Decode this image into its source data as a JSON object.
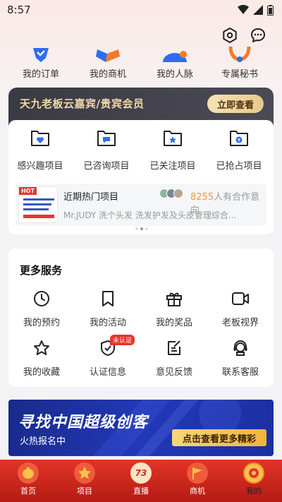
{
  "status_bar": {
    "time": "8:57"
  },
  "top_actions": {
    "settings_icon": "gear-icon",
    "message_icon": "chat-bubble-icon"
  },
  "quick_links": [
    {
      "label": "我的订单",
      "icon": "order-icon"
    },
    {
      "label": "我的商机",
      "icon": "opportunity-icon"
    },
    {
      "label": "我的人脉",
      "icon": "contacts-icon"
    },
    {
      "label": "专属秘书",
      "icon": "secretary-icon"
    }
  ],
  "vip": {
    "title": "天九老板云嘉宾/贵宾会员",
    "button": "立即查看"
  },
  "projects": {
    "items": [
      {
        "label": "感兴趣项目",
        "icon": "folder-heart-icon"
      },
      {
        "label": "已咨询项目",
        "icon": "folder-chat-icon"
      },
      {
        "label": "已关注项目",
        "icon": "folder-star-icon"
      },
      {
        "label": "已抢占项目",
        "icon": "folder-money-icon"
      }
    ],
    "hot": {
      "tag": "HOT",
      "title": "近期热门项目",
      "count": "8255",
      "count_suffix": "人有合作意向",
      "desc": "Mr.JUDY 洗个头发 洗发护发及头皮管理综合..."
    }
  },
  "services": {
    "title": "更多服务",
    "items": [
      {
        "label": "我的预约",
        "icon": "clock-icon"
      },
      {
        "label": "我的活动",
        "icon": "bookmark-icon"
      },
      {
        "label": "我的奖品",
        "icon": "gift-icon"
      },
      {
        "label": "老板视界",
        "icon": "video-camera-icon"
      },
      {
        "label": "我的收藏",
        "icon": "star-icon"
      },
      {
        "label": "认证信息",
        "icon": "shield-check-icon",
        "badge": "未认证"
      },
      {
        "label": "意见反馈",
        "icon": "feedback-icon"
      },
      {
        "label": "联系客服",
        "icon": "headset-icon"
      }
    ]
  },
  "promo": {
    "title": "寻找中国超级创客",
    "subtitle": "火热报名中",
    "button": "点击查看更多精彩"
  },
  "tabs": [
    {
      "label": "首页",
      "icon": "home-lantern-icon"
    },
    {
      "label": "项目",
      "icon": "project-star-icon"
    },
    {
      "label": "直播",
      "icon": "live-73-icon",
      "icon_text": "73"
    },
    {
      "label": "商机",
      "icon": "flag-icon"
    },
    {
      "label": "我的",
      "icon": "profile-coin-icon",
      "active": true
    }
  ],
  "colors": {
    "accent": "#e8352a",
    "gold": "#f2d9a6",
    "promo_blue": "#2238b8"
  }
}
